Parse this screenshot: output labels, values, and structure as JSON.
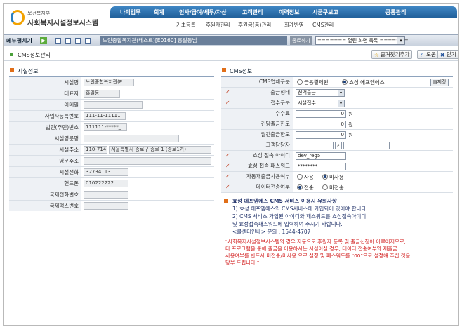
{
  "header": {
    "org": "보건복지부",
    "system": "사회복지시설정보시스템",
    "menu": [
      "나의업무",
      "회계",
      "인사/급여/세무/자산",
      "고객관리",
      "이력정보",
      "시군구보고",
      "공통관리"
    ],
    "submenu": [
      "기초등록",
      "후원자관리",
      "후원금(품)관리",
      "회계반영",
      "CMS관리"
    ]
  },
  "toolbar": {
    "label": "메뉴펼치기",
    "tab": "노인종합복지관(테스트)[E0160] 홍길동님",
    "close": "종료하기",
    "window_select": "======= 열린 화면 목록 ======="
  },
  "page": {
    "title": "CMS정보관리",
    "buttons": {
      "favorite": "즐겨찾기추가",
      "help": "도움",
      "close": "닫기"
    }
  },
  "facility": {
    "title": "시설정보",
    "rows": [
      {
        "label": "시설명",
        "value": "노인종합복지관(E"
      },
      {
        "label": "대표자",
        "value": "홍길동"
      },
      {
        "label": "이메일",
        "value": ""
      },
      {
        "label": "사업자등록번호",
        "value": "111-11-11111"
      },
      {
        "label": "법인(주민)번호",
        "value": "111111-*****_"
      },
      {
        "label": "시설영문명",
        "value": ""
      },
      {
        "label": "시설주소",
        "value": "110-714",
        "value2": "서울특별시 종로구 종로 1    (종로1가)"
      },
      {
        "label": "영문주소",
        "value": ""
      },
      {
        "label": "시설전화",
        "value": "32734113"
      },
      {
        "label": "핸드폰",
        "value": "010222222"
      },
      {
        "label": "국제전화번호",
        "value": ""
      },
      {
        "label": "국제팩스번호",
        "value": ""
      }
    ]
  },
  "cms": {
    "title": "CMS정보",
    "save_label": "저장",
    "rows": {
      "type": {
        "label": "CMS업체구분",
        "opt1": "금융결제원",
        "opt2": "효성 에프엠에스"
      },
      "withdraw": {
        "label": "출금형태",
        "value": "전액출금"
      },
      "receipt": {
        "label": "접수구분",
        "value": "시설접수"
      },
      "fee": {
        "label": "수수료",
        "value": "0",
        "unit": "원"
      },
      "case_limit": {
        "label": "건당출금한도",
        "value": "0",
        "unit": "원"
      },
      "month_limit": {
        "label": "월간출금한도",
        "value": "0",
        "unit": "원"
      },
      "manager": {
        "label": "고객담당자",
        "value": ""
      },
      "hs_id": {
        "label": "효성 접속 아이디",
        "value": "dev_reg5"
      },
      "hs_pw": {
        "label": "효성 접속 패스워드",
        "value": "********"
      },
      "auto": {
        "label": "자동재출금사용여부",
        "opt1": "사용",
        "opt2": "미사용"
      },
      "transfer": {
        "label": "데이터전송여부",
        "opt1": "전송",
        "opt2": "미전송"
      }
    },
    "notes": {
      "title": "효성 에프엠에스 CMS 서비스 이용시 유의사항",
      "line1": "1) 효성 에프엠에스의  CMS서비스에 가입되어 있어야 합니다.",
      "line2": "2) CMS 서비스 가입된 아이디와 패스워드를 효성접속아이디",
      "line3": "및 효성접속패스워드에 입력하여 주시기 바랍니다.",
      "line4": "<콜센터안내> 문의 : 1544-4707"
    },
    "warning": [
      "\"사회복지시설정보시스템의 경우 자동으로 후원자 등록 및 출금신청이 이루어지므로,",
      "타 프로그램을 통해 출금을 이용하시는 시설이실 경우, 데이터 전송여부와 재출금",
      "사용여부를 반드시 미전송/미사용 으로 설정 및 패스워드를 \"00\"으로 설정해 주십 것을",
      "당부 드립니다.\""
    ]
  },
  "colors": {
    "menu": "#2c6cab",
    "accent": "#e06e18",
    "warning": "#d21d1d",
    "notes": "#23346b"
  }
}
